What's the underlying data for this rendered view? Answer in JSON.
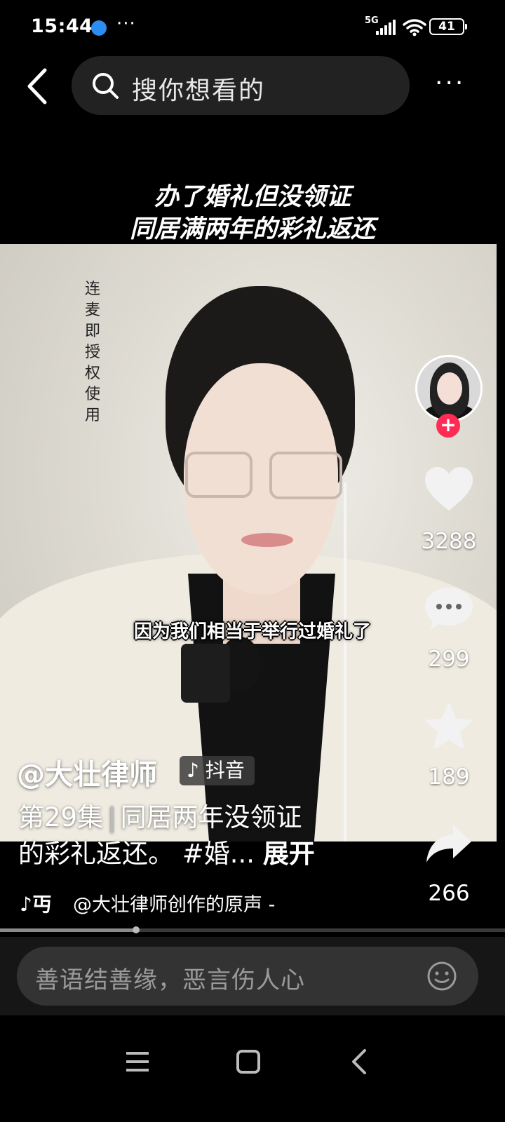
{
  "status_bar": {
    "time": "15:44",
    "more": "···",
    "network": "5G",
    "battery": "41"
  },
  "top_nav": {
    "search_placeholder": "搜你想看的",
    "more": "···"
  },
  "video": {
    "headline_line1": "办了婚礼但没领证",
    "headline_line2": "同居满两年的彩礼返还",
    "vertical_note": "连麦即授权使用",
    "subtitle": "因为我们相当于举行过婚礼了"
  },
  "actions": {
    "like_count": "3288",
    "comment_count": "299",
    "favorite_count": "189",
    "share_count": "266"
  },
  "caption": {
    "author": "@大壮律师",
    "platform_badge": "抖音",
    "episode": "第29集",
    "separator": "|",
    "text_line1": "同居两年没领证",
    "text_line2": "的彩礼返还。 #婚...",
    "expand": "展开",
    "music_icon": "♪丏",
    "music": "@大壮律师创作的原声 -"
  },
  "progress": {
    "fraction": 0.27
  },
  "comment": {
    "placeholder": "善语结善缘，恶言伤人心"
  },
  "colors": {
    "accent": "#fe2c55",
    "background": "#000000"
  }
}
